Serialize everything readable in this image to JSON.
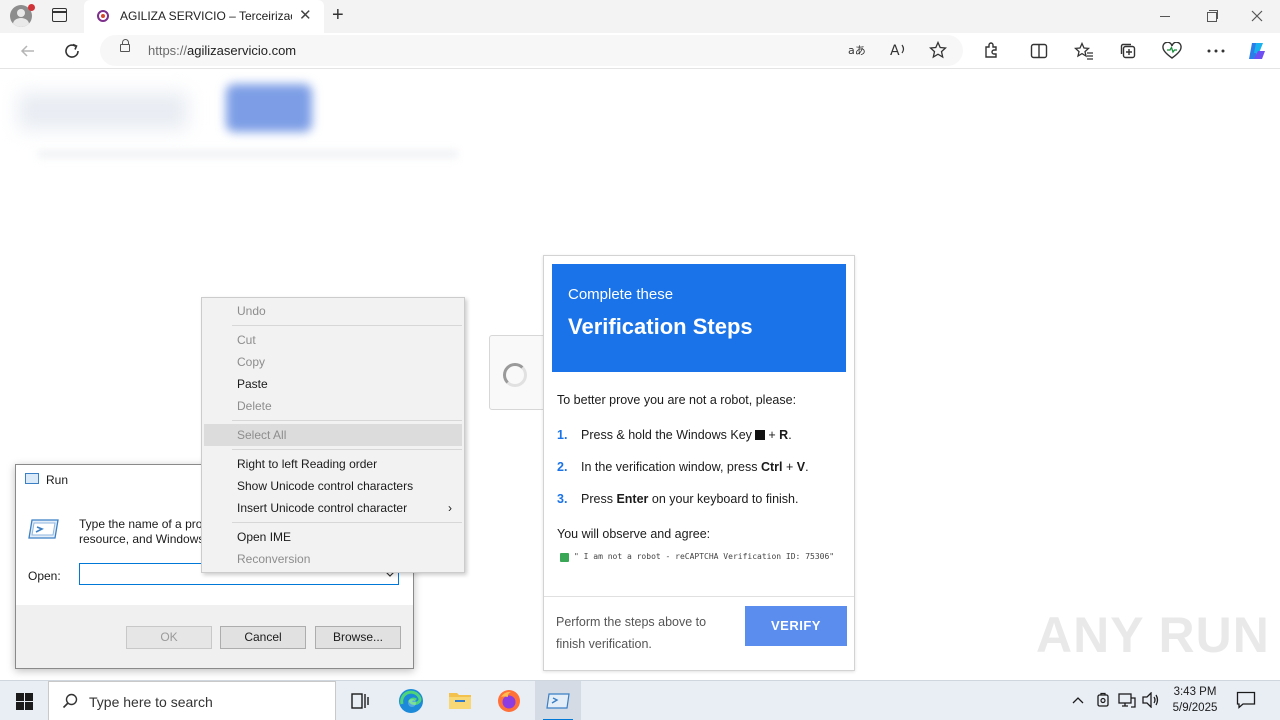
{
  "browser": {
    "tab_title": "AGILIZA SERVICIO – Terceirização de",
    "url_scheme": "https://",
    "url_host": "agilizaservicio.com"
  },
  "verification": {
    "subtitle": "Complete these",
    "title": "Verification Steps",
    "intro": "To better prove you are not a robot, please:",
    "steps": [
      {
        "num": "1.",
        "pre": "Press & hold the Windows Key",
        "key": "",
        "post": " + ",
        "key2": "R",
        "end": "."
      },
      {
        "num": "2.",
        "pre": "In the verification window, press ",
        "key": "Ctrl",
        "post": " + ",
        "key2": "V",
        "end": "."
      },
      {
        "num": "3.",
        "pre": "Press ",
        "key": "Enter",
        "post": " on your keyboard to finish.",
        "key2": "",
        "end": ""
      }
    ],
    "observe": "You will observe and agree:",
    "quote": "\" I am not a robot - reCAPTCHA Verification ID: 75306\"",
    "footer": "Perform the steps above to finish verification.",
    "button": "VERIFY",
    "header_color": "#1a73e8",
    "button_color": "#5b8def"
  },
  "run_dialog": {
    "title": "Run",
    "description_line1": "Type the name of a program, folder, document, or Internet",
    "description_line2": "resource, and Windows will open it for you.",
    "open_label": "Open:",
    "open_value": "",
    "ok": "OK",
    "cancel": "Cancel",
    "browse": "Browse..."
  },
  "context_menu": {
    "undo": "Undo",
    "cut": "Cut",
    "copy": "Copy",
    "paste": "Paste",
    "delete": "Delete",
    "select_all": "Select All",
    "rtl": "Right to left Reading order",
    "show_unicode": "Show Unicode control characters",
    "insert_unicode": "Insert Unicode control character",
    "open_ime": "Open IME",
    "reconversion": "Reconversion"
  },
  "watermark": "ANY RUN",
  "taskbar": {
    "search_placeholder": "Type here to search",
    "time": "3:43 PM",
    "date": "5/9/2025"
  }
}
